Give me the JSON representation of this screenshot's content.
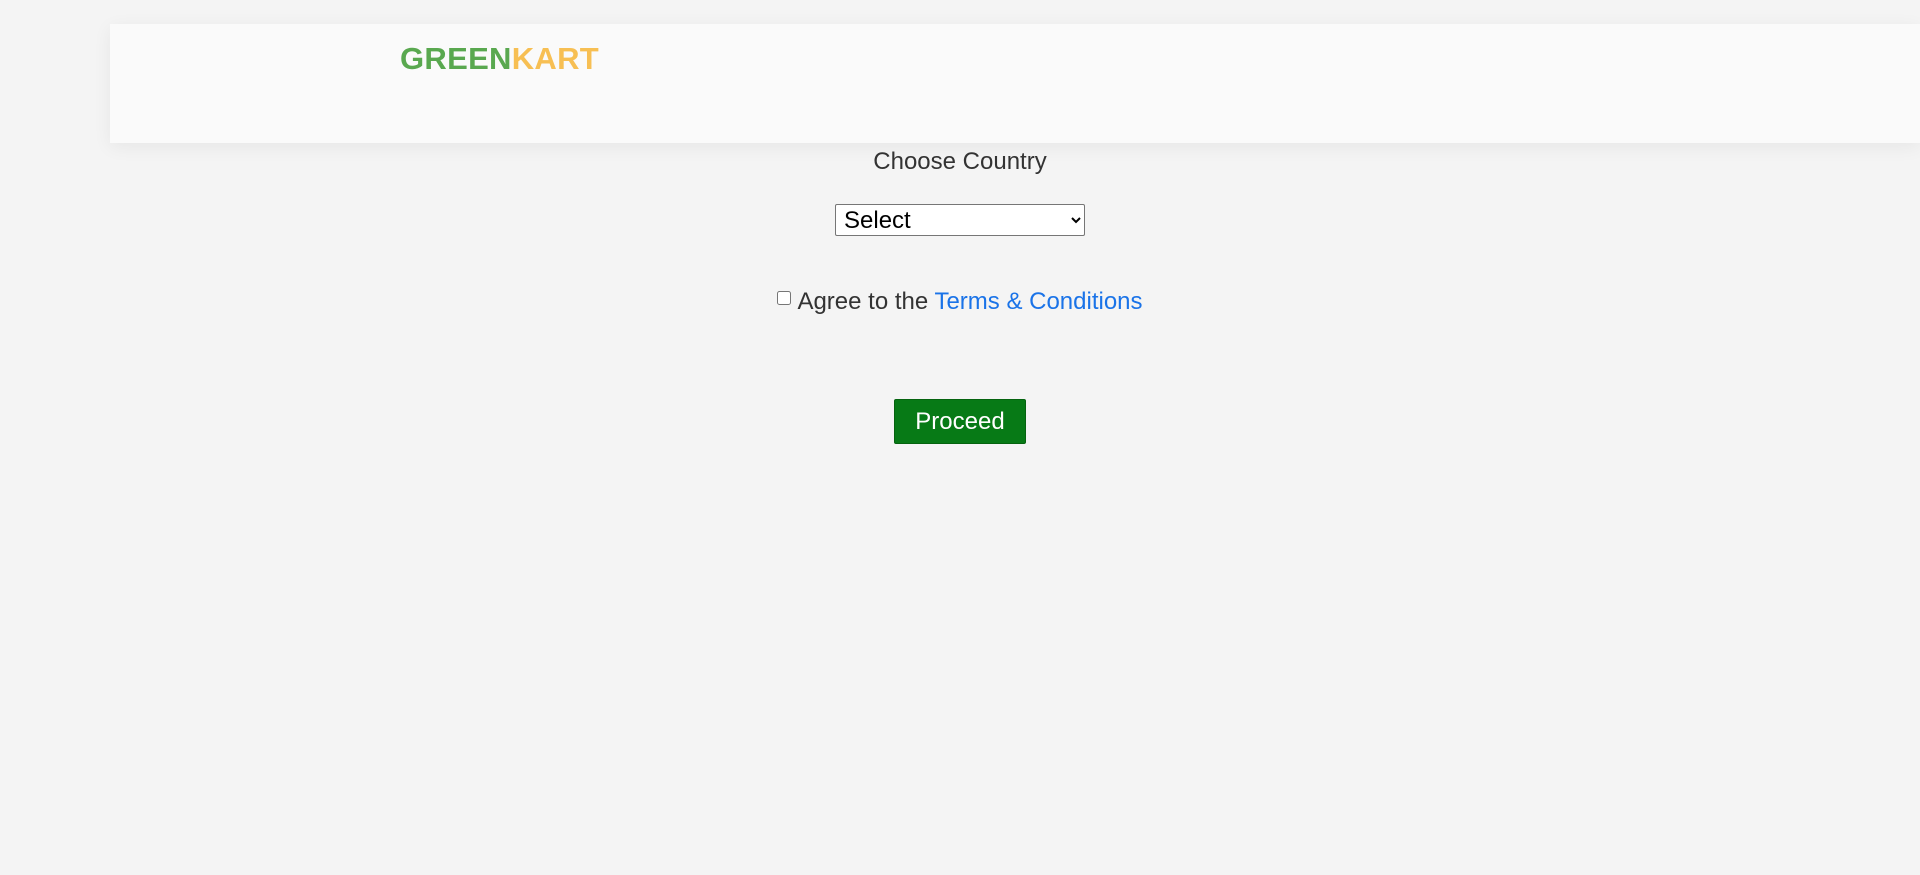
{
  "header": {
    "logo_part1": "GREEN",
    "logo_part2": "KART",
    "logo_color_green": "#59a84f",
    "logo_color_kart": "#f7bf53"
  },
  "form": {
    "choose_country_label": "Choose Country",
    "country_select": {
      "selected": "Select",
      "options": [
        "Select"
      ]
    },
    "agree_prefix": "Agree to the ",
    "terms_link": "Terms & Conditions",
    "agree_checked": false,
    "proceed_label": "Proceed",
    "proceed_color": "#077a16",
    "link_color": "#1a73e8"
  }
}
